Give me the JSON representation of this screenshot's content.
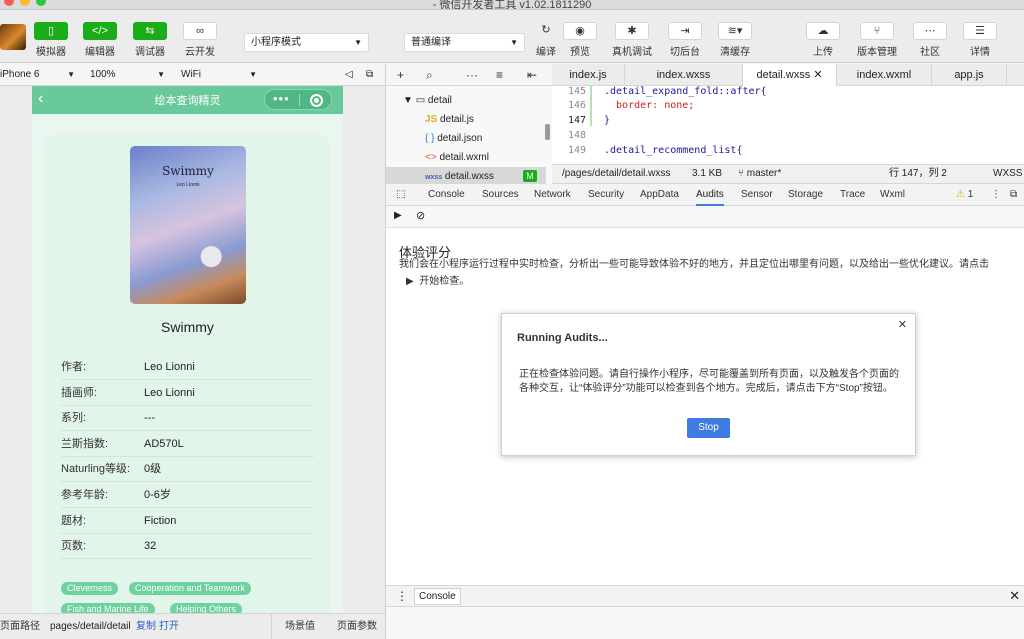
{
  "window": {
    "title": "- 微信开发者工具 v1.02.1811290"
  },
  "toolbar": {
    "simulator": "模拟器",
    "editor": "编辑器",
    "debugger": "调试器",
    "cloud": "云开发",
    "mode": "小程序模式",
    "compile": "普通编译",
    "actions": {
      "compile": "编译",
      "preview": "预览",
      "remote_debug": "真机调试",
      "background": "切后台",
      "clear_cache": "清缓存"
    },
    "right": {
      "upload": "上传",
      "version": "版本管理",
      "community": "社区",
      "details": "详情"
    }
  },
  "device": {
    "model": "iPhone 6",
    "zoom": "100%",
    "network": "WiFi"
  },
  "phone": {
    "nav_title": "绘本查询精灵",
    "cover_title": "Swimmy",
    "cover_author": "Leo Lionni",
    "book_title": "Swimmy",
    "details": [
      {
        "key": "作者:",
        "value": "Leo Lionni"
      },
      {
        "key": "插画师:",
        "value": "Leo Lionni"
      },
      {
        "key": "系列:",
        "value": "---"
      },
      {
        "key": "兰斯指数:",
        "value": "AD570L"
      },
      {
        "key": "Naturling等级:",
        "value": "0级"
      },
      {
        "key": "参考年龄:",
        "value": "0-6岁"
      },
      {
        "key": "题材:",
        "value": "Fiction"
      },
      {
        "key": "页数:",
        "value": "32"
      }
    ],
    "tags": [
      "Cleverness",
      "Cooperation and Teamwork",
      "Fish and Marine Life",
      "Helping Others"
    ]
  },
  "statusbar": {
    "path_label": "页面路径",
    "path": "pages/detail/detail",
    "copy": "复制",
    "open": "打开",
    "scene": "场景值",
    "params": "页面参数"
  },
  "filetree": {
    "folder": "detail",
    "files": [
      "detail.js",
      "detail.json",
      "detail.wxml",
      "detail.wxss"
    ],
    "modified_badge": "M"
  },
  "editor_tabs": [
    "index.js",
    "index.wxss",
    "detail.wxss",
    "index.wxml",
    "app.js"
  ],
  "code": [
    {
      "line": "145",
      "text": ".detail_expand_fold::after{"
    },
    {
      "line": "146",
      "text": "  border: none;"
    },
    {
      "line": "147",
      "text": "}"
    },
    {
      "line": "148",
      "text": ""
    },
    {
      "line": "149",
      "text": ".detail_recommend_list{"
    }
  ],
  "editor_status": {
    "path": "/pages/detail/detail.wxss",
    "size": "3.1 KB",
    "branch": "master*",
    "position": "行 147，列 2",
    "lang": "WXSS"
  },
  "devtools": {
    "tabs": [
      "Console",
      "Sources",
      "Network",
      "Security",
      "AppData",
      "Audits",
      "Sensor",
      "Storage",
      "Trace",
      "Wxml"
    ],
    "warnings": "1"
  },
  "audits": {
    "title": "体验评分",
    "description": "我们会在小程序运行过程中实时检查，分析出一些可能导致体验不好的地方，并且定位出哪里有问题，以及给出一些优化建议。请点击",
    "start": "开始检查。",
    "dialog": {
      "title": "Running Audits...",
      "message": "正在检查体验问题。请自行操作小程序，尽可能覆盖到所有页面，以及触发各个页面的各种交互，让“体验评分”功能可以检查到各个地方。完成后，请点击下方“Stop”按钮。",
      "stop": "Stop"
    }
  },
  "drawer": {
    "tab": "Console"
  },
  "colors": {
    "green": "#1aad19",
    "nav": "#69c99a",
    "tag": "#6dd1a0",
    "accent": "#3e7ce2"
  }
}
